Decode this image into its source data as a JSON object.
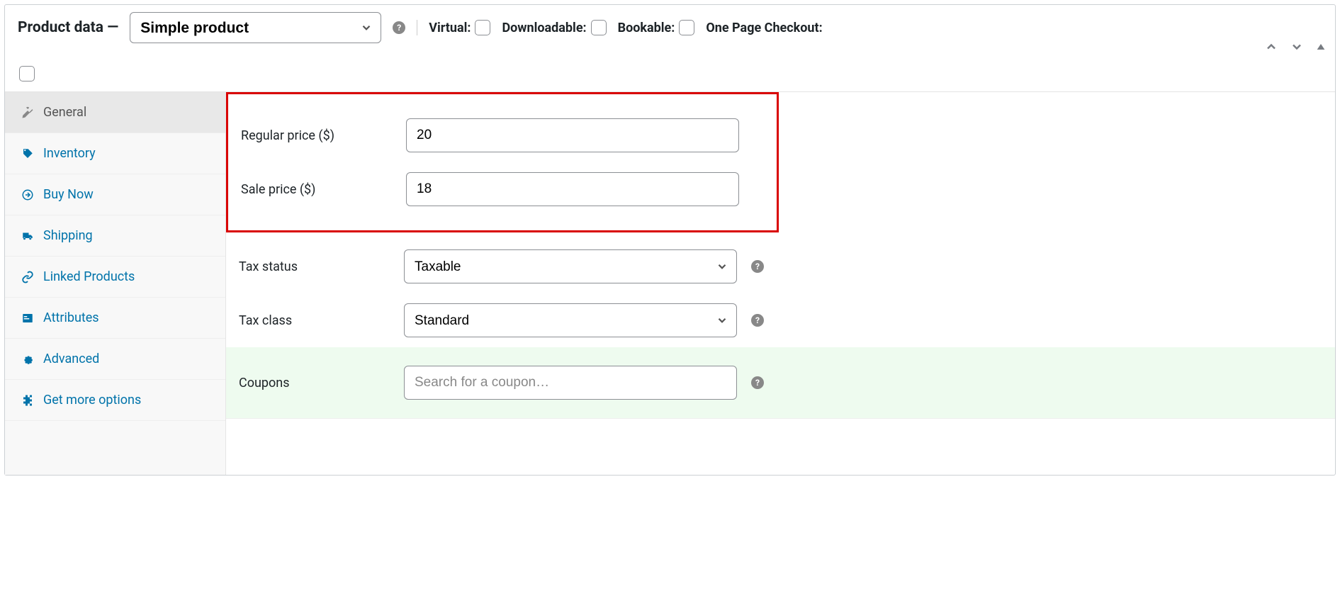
{
  "header": {
    "title": "Product data —",
    "product_type": "Simple product",
    "virtual_label": "Virtual:",
    "downloadable_label": "Downloadable:",
    "bookable_label": "Bookable:",
    "one_page_checkout_label": "One Page Checkout:"
  },
  "tabs": [
    {
      "id": "general",
      "label": "General",
      "icon": "wrench",
      "active": true
    },
    {
      "id": "inventory",
      "label": "Inventory",
      "icon": "tag",
      "active": false
    },
    {
      "id": "buynow",
      "label": "Buy Now",
      "icon": "arrow-right-circle",
      "active": false
    },
    {
      "id": "shipping",
      "label": "Shipping",
      "icon": "truck",
      "active": false
    },
    {
      "id": "linked",
      "label": "Linked Products",
      "icon": "link",
      "active": false
    },
    {
      "id": "attributes",
      "label": "Attributes",
      "icon": "layout",
      "active": false
    },
    {
      "id": "advanced",
      "label": "Advanced",
      "icon": "gear",
      "active": false
    },
    {
      "id": "more",
      "label": "Get more options",
      "icon": "plugin",
      "active": false
    }
  ],
  "fields": {
    "regular_price": {
      "label": "Regular price ($)",
      "value": "20"
    },
    "sale_price": {
      "label": "Sale price ($)",
      "value": "18"
    },
    "tax_status": {
      "label": "Tax status",
      "value": "Taxable"
    },
    "tax_class": {
      "label": "Tax class",
      "value": "Standard"
    },
    "coupons": {
      "label": "Coupons",
      "placeholder": "Search for a coupon…"
    }
  }
}
